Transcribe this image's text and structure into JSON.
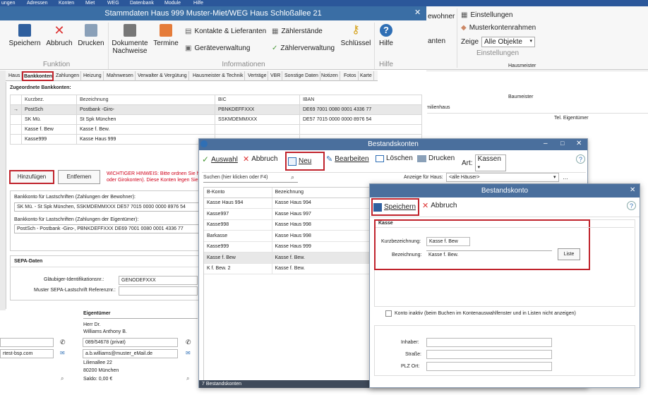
{
  "menubar": {
    "items": [
      "ungen",
      "Adressen",
      "Konten",
      "Miet",
      "WEG",
      "Datenbank",
      "Module",
      "Hilfe"
    ]
  },
  "window1": {
    "title": "Stammdaten Haus 999  Muster-Miet/WEG Haus Schloßallee 21"
  },
  "ribbon": {
    "funktion": {
      "group": "Funktion",
      "speichern": "Speichern",
      "abbruch": "Abbruch",
      "drucken": "Drucken"
    },
    "info": {
      "group": "Informationen",
      "dokumente_l1": "Dokumente",
      "dokumente_l2": "Nachweise",
      "termine": "Termine",
      "kontakte": "Kontakte & Lieferanten",
      "geraete": "Geräteverwaltung",
      "zaehlerstaende": "Zählerstände",
      "zaehlerverwaltung": "Zählerverwaltung",
      "schluessel": "Schlüssel"
    },
    "hilfe": {
      "label": "Hilfe",
      "group": "Hilfe"
    },
    "right": {
      "einstellungen": "Einstellungen",
      "musterkontenrahmen": "Musterkontenrahmen",
      "zeige_label": "Zeige",
      "zeige_value": "Alle Objekte",
      "group": "Einstellungen",
      "bewohner": "ewohner",
      "anten": "anten"
    }
  },
  "tabs": [
    "Haus",
    "Bankkonten",
    "Zahlungen",
    "Heizung",
    "Mahnwesen",
    "Verwalter & Vergütung",
    "Hausmeister & Technik",
    "Verträge",
    "VBR",
    "Sonstige Daten",
    "Notizen",
    "Fotos",
    "Karte"
  ],
  "bank": {
    "heading": "Zugeordnete Bankkonten:",
    "columns": [
      "Kurzbez.",
      "Bezeichnung",
      "BIC",
      "IBAN"
    ],
    "rows": [
      [
        "PostSch",
        "Postbank -Giro-",
        "PBNKDEFFXXX",
        "DE69 7001 0080 0001 4336 77"
      ],
      [
        "SK Mü.",
        "St Spk München",
        "SSKMDEMMXXX",
        "DE57 7015 0000 0000 8976 54"
      ],
      [
        "Kasse f. Bew",
        "Kasse f. Bew.",
        "",
        ""
      ],
      [
        "Kasse999",
        "Kasse Haus 999",
        "",
        ""
      ]
    ],
    "hinzufuegen": "Hinzufügen",
    "entfernen": "Entfernen",
    "hinweis_l1": "WICHTIGER HINWEIS: Bitte ordnen Sie hi",
    "hinweis_l2": "oder Girokonten). Diese Konten legen Sie",
    "lastschrift_bewohner_label": "Bankkonto für Lastschriften (Zahlungen der Bewohner):",
    "lastschrift_bewohner_value": "SK Mü. - St Spk München, SSKMDEMMXXX  DE57 7015 0000 0000 8976 54",
    "lastschrift_eigentuemer_label": "Bankkonto für Lastschriften (Zahlungen der Eigentümer):",
    "lastschrift_eigentuemer_value": "PostSch - Postbank -Giro-, PBNKDEFFXXX  DE69 7001 0080 0001 4336 77"
  },
  "sepa": {
    "heading": "SEPA-Daten",
    "glaeubiger_label": "Gläubiger-Identifikationsnr.:",
    "glaeubiger_value": "GENODEFXXX",
    "referenz_label": "Muster SEPA-Lastschrift Referenznr.:"
  },
  "background": {
    "hausmeister": "Hausmeister",
    "baumeister": "Baumeister",
    "tel_eigentuemer": "Tel. Eigentümer",
    "milienhaus": "milienhaus",
    "eigentuemer_heading": "Eigentümer",
    "herr": "Herr Dr.",
    "name": "Williams Anthony B.",
    "phone": "089/54678 (privat)",
    "email": "a.b.williams@muster_eMail.de",
    "street": "Lilienallee 22",
    "city": "80200 München",
    "saldo": "Saldo:  0,00 €",
    "left_email": "rtest-bsp.com"
  },
  "bestandskonten": {
    "title": "Bestandskonten",
    "toolbar": {
      "auswahl": "Auswahl",
      "abbruch": "Abbruch",
      "neu": "Neu",
      "bearbeiten": "Bearbeiten",
      "loeschen": "Löschen",
      "drucken": "Drucken",
      "art_label": "Art:",
      "art_value": "Kassen"
    },
    "search_placeholder": "Suchen (hier klicken oder F4)",
    "anzeige_label": "Anzeige für Haus:",
    "anzeige_value": "<alle Häuser>",
    "columns": [
      "B-Konto",
      "Bezeichnung"
    ],
    "rows": [
      [
        "Kasse Haus 994",
        "Kasse Haus 994"
      ],
      [
        "Kasse997",
        "Kasse Haus 997"
      ],
      [
        "Kasse998",
        "Kasse Haus 998"
      ],
      [
        "Barkasse",
        "Kasse Haus 998"
      ],
      [
        "Kasse999",
        "Kasse Haus 999"
      ],
      [
        "Kasse f. Bew",
        "Kasse f. Bew."
      ],
      [
        "K f. Bew. 2",
        "Kasse f. Bew."
      ]
    ],
    "status": "7 Bestandskonten"
  },
  "bestandskonto": {
    "title": "Bestandskonto",
    "speichern": "Speichern",
    "abbruch": "Abbruch",
    "section": "Kasse",
    "kurz_label": "Kurzbezeichnung:",
    "kurz_value": "Kasse f. Bew",
    "bez_label": "Bezeichnung:",
    "bez_value": "Kasse f. Bew.",
    "liste": "Liste",
    "inaktiv": "Konto inaktiv (beim Buchen im Kontenauswahlfenster und in Listen nicht anzeigen)",
    "inhaber": "Inhaber:",
    "strasse": "Straße:",
    "plz": "PLZ Ort:"
  },
  "colors": {
    "titlebar": "#4a6f9d",
    "highlight": "#c0232c",
    "menubar": "#2b579a"
  }
}
